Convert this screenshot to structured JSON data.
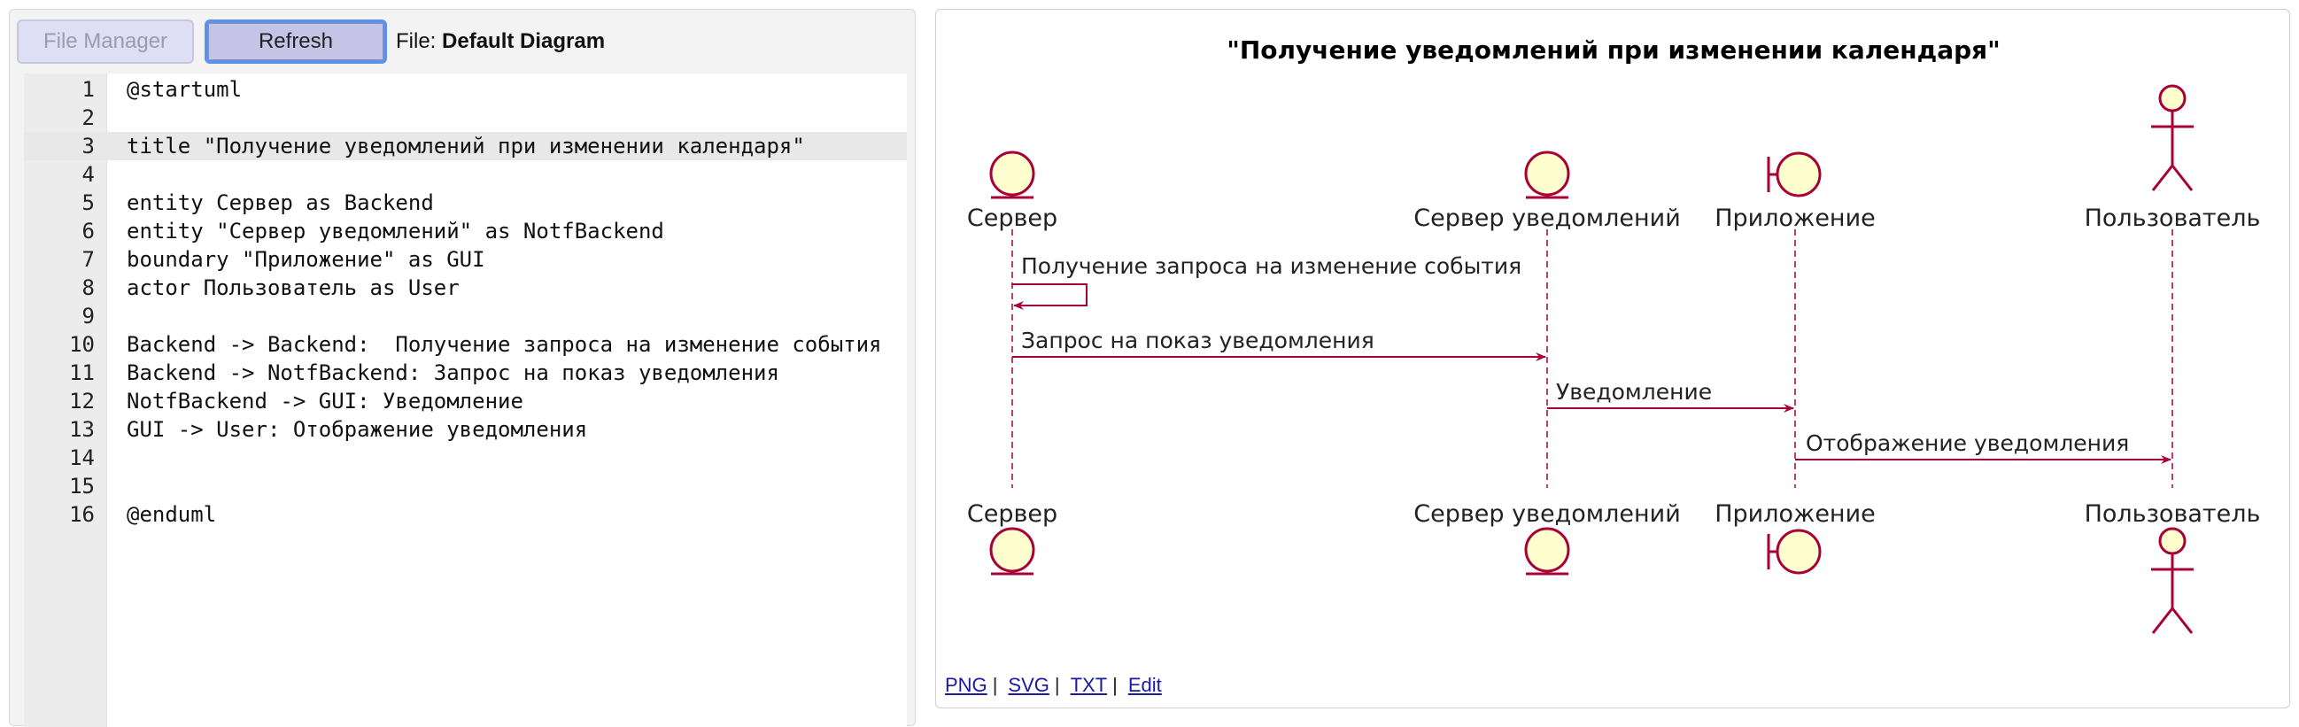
{
  "toolbar": {
    "file_manager_label": "File Manager",
    "refresh_label": "Refresh",
    "file_prefix": "File:",
    "file_name": "Default Diagram"
  },
  "editor": {
    "active_line": 3,
    "lines": [
      {
        "num": "1",
        "text": "@startuml"
      },
      {
        "num": "2",
        "text": ""
      },
      {
        "num": "3",
        "text": "title \"Получение уведомлений при изменении календаря\""
      },
      {
        "num": "4",
        "text": ""
      },
      {
        "num": "5",
        "text": "entity Сервер as Backend"
      },
      {
        "num": "6",
        "text": "entity \"Сервер уведомлений\" as NotfBackend"
      },
      {
        "num": "7",
        "text": "boundary \"Приложение\" as GUI"
      },
      {
        "num": "8",
        "text": "actor Пользователь as User"
      },
      {
        "num": "9",
        "text": ""
      },
      {
        "num": "10",
        "text": "Backend -> Backend:  Получение запроса на изменение события"
      },
      {
        "num": "11",
        "text": "Backend -> NotfBackend: Запрос на показ уведомления"
      },
      {
        "num": "12",
        "text": "NotfBackend -> GUI: Уведомление"
      },
      {
        "num": "13",
        "text": "GUI -> User: Отображение уведомления"
      },
      {
        "num": "14",
        "text": ""
      },
      {
        "num": "15",
        "text": ""
      },
      {
        "num": "16",
        "text": "@enduml"
      }
    ]
  },
  "diagram": {
    "title": "\"Получение уведомлений при изменении календаря\"",
    "participants": [
      {
        "label": "Сервер",
        "kind": "entity"
      },
      {
        "label": "Сервер уведомлений",
        "kind": "entity"
      },
      {
        "label": "Приложение",
        "kind": "boundary"
      },
      {
        "label": "Пользователь",
        "kind": "actor"
      }
    ],
    "messages": [
      {
        "text": "Получение запроса на изменение события"
      },
      {
        "text": "Запрос на показ уведомления"
      },
      {
        "text": "Уведомление"
      },
      {
        "text": "Отображение уведомления"
      }
    ],
    "colors": {
      "fill": "#fefece",
      "stroke": "#a80036",
      "text": "#222222"
    }
  },
  "links": {
    "png": "PNG",
    "svg": "SVG",
    "txt": "TXT",
    "edit": "Edit",
    "separator": "|"
  }
}
